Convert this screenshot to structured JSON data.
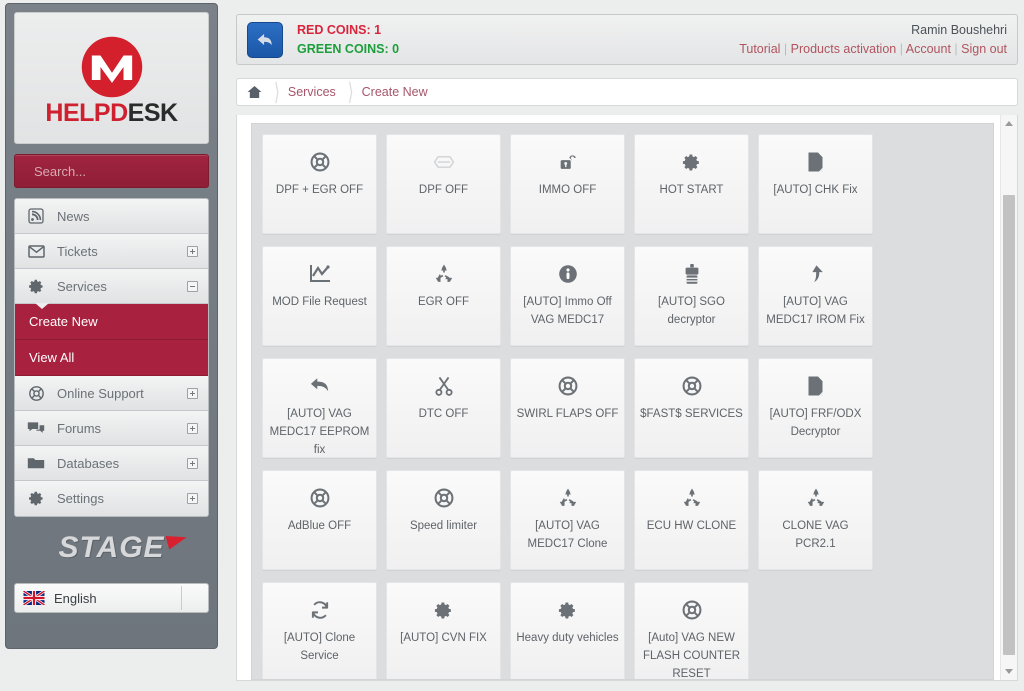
{
  "brand": {
    "logo_word_red": "HELPD",
    "logo_word_dark": "ESK",
    "footer_logo": "STAGE",
    "accent_red": "#a8223f",
    "accent_dark_red": "#8e1e36",
    "brand_red": "#cf2030"
  },
  "search": {
    "placeholder": "Search...",
    "value": ""
  },
  "sidebar": {
    "items": [
      {
        "label": "News",
        "icon": "rss-icon",
        "expander": "none"
      },
      {
        "label": "Tickets",
        "icon": "envelope-icon",
        "expander": "plus"
      },
      {
        "label": "Services",
        "icon": "gear-icon",
        "expander": "minus"
      },
      {
        "label": "Online Support",
        "icon": "lifebuoy-icon",
        "expander": "plus"
      },
      {
        "label": "Forums",
        "icon": "comments-icon",
        "expander": "plus"
      },
      {
        "label": "Databases",
        "icon": "folder-icon",
        "expander": "plus"
      },
      {
        "label": "Settings",
        "icon": "gear-icon",
        "expander": "plus"
      }
    ],
    "submenu": [
      {
        "label": "Create New",
        "active": true
      },
      {
        "label": "View All",
        "active": false
      }
    ],
    "language": "English"
  },
  "topbar": {
    "back_icon": "back-arrow-icon",
    "red_coins_label": "RED COINS:",
    "red_coins_value": "1",
    "green_coins_label": "GREEN COINS:",
    "green_coins_value": "0",
    "red_coins_text": "RED COINS: 1",
    "green_coins_text": "GREEN COINS: 0",
    "username": "Ramin Boushehri",
    "links": [
      "Tutorial",
      "Products activation",
      "Account",
      "Sign out"
    ]
  },
  "breadcrumb": {
    "home_icon": "home-icon",
    "items": [
      "Services",
      "Create New"
    ]
  },
  "services": [
    {
      "label": "DPF + EGR OFF",
      "icon": "lifebuoy-icon"
    },
    {
      "label": "DPF OFF",
      "icon": "arrows-horizontal-icon"
    },
    {
      "label": "IMMO OFF",
      "icon": "unlock-icon"
    },
    {
      "label": "HOT START",
      "icon": "gear-icon"
    },
    {
      "label": "[AUTO] CHK Fix",
      "icon": "file-icon"
    },
    {
      "label": "MOD File Request",
      "icon": "chart-line-icon"
    },
    {
      "label": "EGR OFF",
      "icon": "recycle-icon"
    },
    {
      "label": "[AUTO] Immo Off VAG MEDC17",
      "icon": "info-circle-icon"
    },
    {
      "label": "[AUTO] SGO decryptor",
      "icon": "barcode-icon"
    },
    {
      "label": "[AUTO] VAG MEDC17 IROM Fix",
      "icon": "arrow-up-curve-icon"
    },
    {
      "label": "[AUTO] VAG MEDC17 EEPROM fix",
      "icon": "reply-arrow-icon"
    },
    {
      "label": "DTC OFF",
      "icon": "scissors-icon"
    },
    {
      "label": "SWIRL FLAPS OFF",
      "icon": "lifebuoy-icon"
    },
    {
      "label": "$FAST$ SERVICES",
      "icon": "lifebuoy-icon"
    },
    {
      "label": "[AUTO] FRF/ODX Decryptor",
      "icon": "file-icon"
    },
    {
      "label": "AdBlue OFF",
      "icon": "lifebuoy-icon"
    },
    {
      "label": "Speed limiter",
      "icon": "lifebuoy-icon"
    },
    {
      "label": "[AUTO] VAG MEDC17 Clone",
      "icon": "recycle-icon"
    },
    {
      "label": "ECU HW CLONE",
      "icon": "recycle-icon"
    },
    {
      "label": "CLONE VAG PCR2.1",
      "icon": "recycle-icon"
    },
    {
      "label": "[AUTO] Clone Service",
      "icon": "refresh-icon"
    },
    {
      "label": "[AUTO] CVN FIX",
      "icon": "gear-icon"
    },
    {
      "label": "Heavy duty vehicles",
      "icon": "gear-icon"
    },
    {
      "label": "[Auto] VAG NEW FLASH COUNTER RESET",
      "icon": "lifebuoy-icon"
    }
  ],
  "scrollbar": {
    "up_icon": "chevron-up-icon",
    "down_icon": "chevron-down-icon"
  }
}
